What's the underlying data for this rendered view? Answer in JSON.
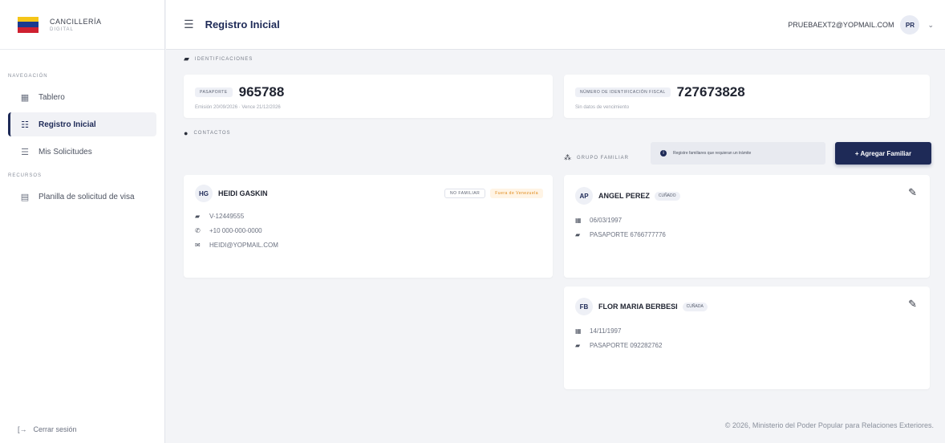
{
  "brand": {
    "title": "CANCILLERÍA",
    "subtitle": "DIGITAL"
  },
  "colors": {
    "primary": "#1e2a57",
    "flag_yellow": "#f5c518",
    "flag_blue": "#1a3a8f",
    "flag_red": "#cf2030"
  },
  "sidebar": {
    "nav_label": "NAVEGACIÓN",
    "items": [
      {
        "label": "Tablero",
        "icon": "dashboard-icon"
      },
      {
        "label": "Registro Inicial",
        "icon": "register-icon",
        "active": true
      },
      {
        "label": "Mis Solicitudes",
        "icon": "list-icon"
      }
    ],
    "resources_label": "RECURSOS",
    "resources": [
      {
        "label": "Planilla de solicitud de visa",
        "icon": "document-icon"
      }
    ],
    "logout": "Cerrar sesión"
  },
  "header": {
    "title": "Registro Inicial",
    "user_email": "PRUEBAEXT2@YOPMAIL.COM",
    "avatar": "PR"
  },
  "identificaciones": {
    "heading": "IDENTIFICACIONES",
    "passport": {
      "label": "PASAPORTE",
      "number": "965788",
      "dates": "Emisión 20/09/2026 · Vence 21/12/2026"
    },
    "fiscal": {
      "label": "NÚMERO DE IDENTIFICACIÓN FISCAL",
      "number": "727673828",
      "note": "Sin datos de vencimiento"
    }
  },
  "contactos": {
    "heading": "CONTACTOS",
    "person": {
      "initials": "HG",
      "name": "HEIDI GASKIN",
      "chip": "NO FAMILIAR",
      "status": "Fuera de Venezuela",
      "id": "V-12449555",
      "phone": "+10 000-000-0000",
      "email": "HEIDI@YOPMAIL.COM"
    }
  },
  "grupo_familiar": {
    "heading": "GRUPO FAMILIAR",
    "info": "Registre familiares que requieran un trámite",
    "add_button": "+ Agregar Familiar",
    "members": [
      {
        "initials": "AP",
        "name": "ANGEL PEREZ",
        "relation": "CUÑADO",
        "date": "06/03/1997",
        "doc": "PASAPORTE 6766777776"
      },
      {
        "initials": "FB",
        "name": "FLOR MARIA BERBESI",
        "relation": "CUÑADA",
        "date": "14/11/1997",
        "doc": "PASAPORTE 092282762"
      }
    ]
  },
  "footer": "© 2026, Ministerio del Poder Popular para Relaciones Exteriores."
}
